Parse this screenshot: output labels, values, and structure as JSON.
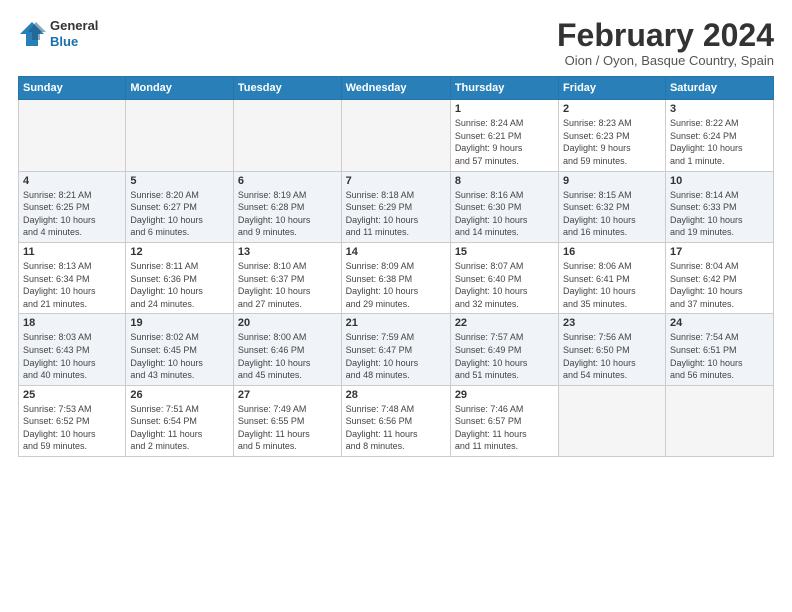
{
  "header": {
    "logo_general": "General",
    "logo_blue": "Blue",
    "month_title": "February 2024",
    "location": "Oion / Oyon, Basque Country, Spain"
  },
  "days_of_week": [
    "Sunday",
    "Monday",
    "Tuesday",
    "Wednesday",
    "Thursday",
    "Friday",
    "Saturday"
  ],
  "weeks": [
    {
      "id": "week1",
      "days": [
        {
          "num": "",
          "info": "",
          "empty": true
        },
        {
          "num": "",
          "info": "",
          "empty": true
        },
        {
          "num": "",
          "info": "",
          "empty": true
        },
        {
          "num": "",
          "info": "",
          "empty": true
        },
        {
          "num": "1",
          "info": "Sunrise: 8:24 AM\nSunset: 6:21 PM\nDaylight: 9 hours\nand 57 minutes.",
          "empty": false
        },
        {
          "num": "2",
          "info": "Sunrise: 8:23 AM\nSunset: 6:23 PM\nDaylight: 9 hours\nand 59 minutes.",
          "empty": false
        },
        {
          "num": "3",
          "info": "Sunrise: 8:22 AM\nSunset: 6:24 PM\nDaylight: 10 hours\nand 1 minute.",
          "empty": false
        }
      ]
    },
    {
      "id": "week2",
      "days": [
        {
          "num": "4",
          "info": "Sunrise: 8:21 AM\nSunset: 6:25 PM\nDaylight: 10 hours\nand 4 minutes.",
          "empty": false
        },
        {
          "num": "5",
          "info": "Sunrise: 8:20 AM\nSunset: 6:27 PM\nDaylight: 10 hours\nand 6 minutes.",
          "empty": false
        },
        {
          "num": "6",
          "info": "Sunrise: 8:19 AM\nSunset: 6:28 PM\nDaylight: 10 hours\nand 9 minutes.",
          "empty": false
        },
        {
          "num": "7",
          "info": "Sunrise: 8:18 AM\nSunset: 6:29 PM\nDaylight: 10 hours\nand 11 minutes.",
          "empty": false
        },
        {
          "num": "8",
          "info": "Sunrise: 8:16 AM\nSunset: 6:30 PM\nDaylight: 10 hours\nand 14 minutes.",
          "empty": false
        },
        {
          "num": "9",
          "info": "Sunrise: 8:15 AM\nSunset: 6:32 PM\nDaylight: 10 hours\nand 16 minutes.",
          "empty": false
        },
        {
          "num": "10",
          "info": "Sunrise: 8:14 AM\nSunset: 6:33 PM\nDaylight: 10 hours\nand 19 minutes.",
          "empty": false
        }
      ]
    },
    {
      "id": "week3",
      "days": [
        {
          "num": "11",
          "info": "Sunrise: 8:13 AM\nSunset: 6:34 PM\nDaylight: 10 hours\nand 21 minutes.",
          "empty": false
        },
        {
          "num": "12",
          "info": "Sunrise: 8:11 AM\nSunset: 6:36 PM\nDaylight: 10 hours\nand 24 minutes.",
          "empty": false
        },
        {
          "num": "13",
          "info": "Sunrise: 8:10 AM\nSunset: 6:37 PM\nDaylight: 10 hours\nand 27 minutes.",
          "empty": false
        },
        {
          "num": "14",
          "info": "Sunrise: 8:09 AM\nSunset: 6:38 PM\nDaylight: 10 hours\nand 29 minutes.",
          "empty": false
        },
        {
          "num": "15",
          "info": "Sunrise: 8:07 AM\nSunset: 6:40 PM\nDaylight: 10 hours\nand 32 minutes.",
          "empty": false
        },
        {
          "num": "16",
          "info": "Sunrise: 8:06 AM\nSunset: 6:41 PM\nDaylight: 10 hours\nand 35 minutes.",
          "empty": false
        },
        {
          "num": "17",
          "info": "Sunrise: 8:04 AM\nSunset: 6:42 PM\nDaylight: 10 hours\nand 37 minutes.",
          "empty": false
        }
      ]
    },
    {
      "id": "week4",
      "days": [
        {
          "num": "18",
          "info": "Sunrise: 8:03 AM\nSunset: 6:43 PM\nDaylight: 10 hours\nand 40 minutes.",
          "empty": false
        },
        {
          "num": "19",
          "info": "Sunrise: 8:02 AM\nSunset: 6:45 PM\nDaylight: 10 hours\nand 43 minutes.",
          "empty": false
        },
        {
          "num": "20",
          "info": "Sunrise: 8:00 AM\nSunset: 6:46 PM\nDaylight: 10 hours\nand 45 minutes.",
          "empty": false
        },
        {
          "num": "21",
          "info": "Sunrise: 7:59 AM\nSunset: 6:47 PM\nDaylight: 10 hours\nand 48 minutes.",
          "empty": false
        },
        {
          "num": "22",
          "info": "Sunrise: 7:57 AM\nSunset: 6:49 PM\nDaylight: 10 hours\nand 51 minutes.",
          "empty": false
        },
        {
          "num": "23",
          "info": "Sunrise: 7:56 AM\nSunset: 6:50 PM\nDaylight: 10 hours\nand 54 minutes.",
          "empty": false
        },
        {
          "num": "24",
          "info": "Sunrise: 7:54 AM\nSunset: 6:51 PM\nDaylight: 10 hours\nand 56 minutes.",
          "empty": false
        }
      ]
    },
    {
      "id": "week5",
      "days": [
        {
          "num": "25",
          "info": "Sunrise: 7:53 AM\nSunset: 6:52 PM\nDaylight: 10 hours\nand 59 minutes.",
          "empty": false
        },
        {
          "num": "26",
          "info": "Sunrise: 7:51 AM\nSunset: 6:54 PM\nDaylight: 11 hours\nand 2 minutes.",
          "empty": false
        },
        {
          "num": "27",
          "info": "Sunrise: 7:49 AM\nSunset: 6:55 PM\nDaylight: 11 hours\nand 5 minutes.",
          "empty": false
        },
        {
          "num": "28",
          "info": "Sunrise: 7:48 AM\nSunset: 6:56 PM\nDaylight: 11 hours\nand 8 minutes.",
          "empty": false
        },
        {
          "num": "29",
          "info": "Sunrise: 7:46 AM\nSunset: 6:57 PM\nDaylight: 11 hours\nand 11 minutes.",
          "empty": false
        },
        {
          "num": "",
          "info": "",
          "empty": true
        },
        {
          "num": "",
          "info": "",
          "empty": true
        }
      ]
    }
  ]
}
